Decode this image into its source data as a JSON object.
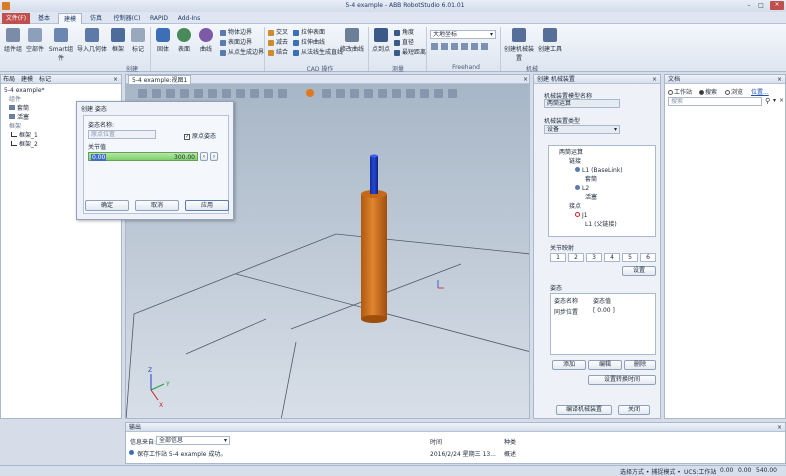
{
  "title": "5-4 example - ABB RobotStudio 6.01.01",
  "tabs": [
    "文件(F)",
    "基本",
    "建模",
    "仿真",
    "控制器(C)",
    "RAPID",
    "Add-Ins"
  ],
  "ribbon": {
    "create": [
      "组件组",
      "空部件",
      "Smart组件",
      "导入几何体",
      "框架",
      "标记"
    ],
    "solids": [
      "固体",
      "表面",
      "曲线"
    ],
    "edge_col1": [
      "物体边界",
      "表面边界",
      "从点生成边界"
    ],
    "cad_col1": [
      "交叉",
      "减去",
      "结合"
    ],
    "cad_col2": [
      "拉伸表面",
      "拉伸曲线",
      "从法线生成直线"
    ],
    "modify": "修改曲线",
    "measure_big": "点到点",
    "measure_small": [
      "角度",
      "直径",
      "最短距离"
    ],
    "freehand_select": "大地坐标",
    "mechanism": [
      "创建机械装置",
      "创建工具"
    ],
    "groups": [
      "创建",
      "CAD 操作",
      "测量",
      "Freehand",
      "机械"
    ]
  },
  "left_panel": {
    "tabs": [
      "布局",
      "建模",
      "标记"
    ],
    "tree": [
      "5-4 example*",
      "组件",
      "套筒",
      "活塞",
      "框架",
      "框架_1",
      "框架_2"
    ]
  },
  "viewport": {
    "tab": "5-4 example:视图1"
  },
  "dialog": {
    "title": "创建 姿态",
    "name_label": "姿态名称:",
    "name_value": "原点位置",
    "checkbox": "原点姿态",
    "joint_label": "关节值",
    "slider_min": "0.00",
    "slider_max": "300.00",
    "buttons": [
      "确定",
      "取消",
      "应用"
    ]
  },
  "mech_panel": {
    "tabs": [
      "创建 机械装置"
    ],
    "model_name_label": "机械装置模型名称",
    "model_name": "两筒运算",
    "type_label": "机械装置类型",
    "type": "设备",
    "tree": [
      "两筒运算",
      "链接",
      "L1 (BaseLink)",
      "套筒",
      "L2",
      "活塞",
      "接点",
      "J1",
      "L1 (父链接)"
    ],
    "joint_map_label": "关节映射",
    "joint_map_values": [
      "1",
      "2",
      "3",
      "4",
      "5",
      "6"
    ],
    "set_btn": "设置",
    "pose_label": "姿态",
    "pose_headers": [
      "姿态名称",
      "姿态值"
    ],
    "pose_row": [
      "同步位置",
      "[ 0.00 ]"
    ],
    "pose_buttons": [
      "添加",
      "编辑",
      "删除"
    ],
    "transition_btn": "设置转换时间",
    "compile_btn": "编译机械装置",
    "close_btn": "关闭"
  },
  "doc_panel": {
    "title": "文档",
    "radios": [
      "工作站",
      "搜索",
      "浏览"
    ],
    "link": "位置...",
    "search_placeholder": "搜索"
  },
  "output": {
    "title": "输出",
    "headers": [
      "信息来自:",
      "时间",
      "种类"
    ],
    "filter": "全部信息",
    "row": [
      "保存工作站 5-4 example 成功。",
      "2016/2/24 星期三 13...",
      "概述"
    ]
  },
  "status": {
    "selection": "选择方式 • 捕捉模式 •",
    "ucs": "UCS:工作站",
    "coords": [
      "0.00",
      "0.00",
      "540.00"
    ]
  },
  "colors": {
    "accent": "#c0504d",
    "cylinder": "#dc7820",
    "rod": "#1d3ec8",
    "viewport_top": "#a7b6c6",
    "viewport_bottom": "#d8dfe8"
  }
}
